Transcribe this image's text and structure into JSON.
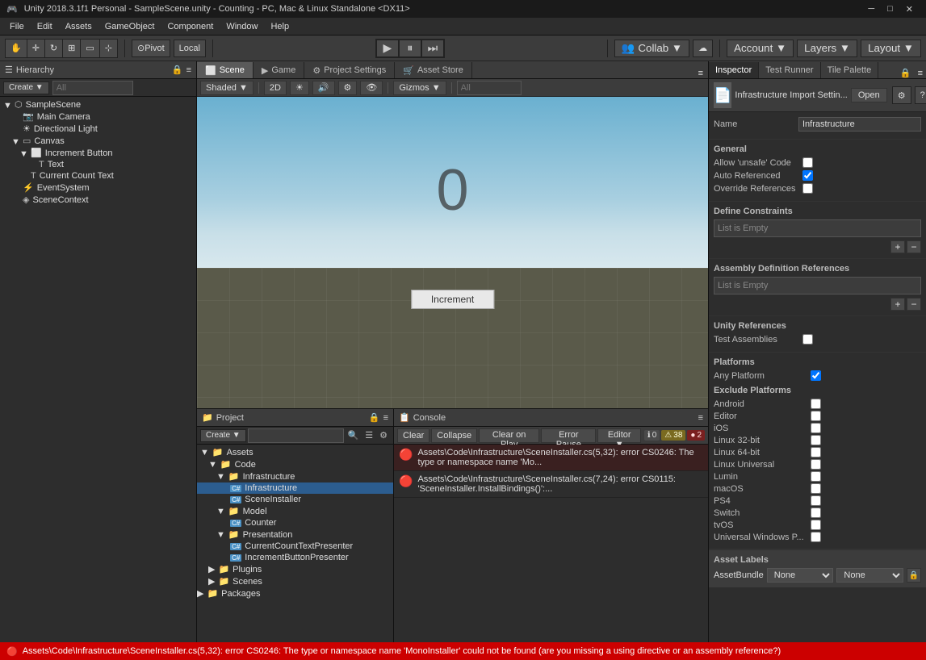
{
  "titlebar": {
    "text": "Unity 2018.3.1f1 Personal - SampleScene.unity - Counting - PC, Mac & Linux Standalone <DX11>"
  },
  "menubar": {
    "items": [
      "File",
      "Edit",
      "Assets",
      "GameObject",
      "Component",
      "Window",
      "Help"
    ]
  },
  "toolbar": {
    "pivot_label": "Pivot",
    "local_label": "Local",
    "play_icon": "▶",
    "pause_icon": "⏸",
    "step_icon": "⏭",
    "collab_label": "Collab ▼",
    "cloud_icon": "☁",
    "account_label": "Account ▼",
    "layers_label": "Layers ▼",
    "layout_label": "Layout ▼"
  },
  "hierarchy": {
    "title": "Hierarchy",
    "create_label": "Create ▼",
    "search_placeholder": "All",
    "items": [
      {
        "id": "samplescene",
        "label": "SampleScene",
        "indent": 0,
        "icon": "scene",
        "expanded": true
      },
      {
        "id": "maincamera",
        "label": "Main Camera",
        "indent": 1,
        "icon": "camera"
      },
      {
        "id": "directionallight",
        "label": "Directional Light",
        "indent": 1,
        "icon": "light"
      },
      {
        "id": "canvas",
        "label": "Canvas",
        "indent": 1,
        "icon": "canvas",
        "expanded": true
      },
      {
        "id": "incrementbutton",
        "label": "Increment Button",
        "indent": 2,
        "icon": "button",
        "expanded": true
      },
      {
        "id": "text",
        "label": "Text",
        "indent": 3,
        "icon": "text"
      },
      {
        "id": "currentcounttext",
        "label": "Current Count Text",
        "indent": 2,
        "icon": "text"
      },
      {
        "id": "eventsystem",
        "label": "EventSystem",
        "indent": 1,
        "icon": "event"
      },
      {
        "id": "scenecontext",
        "label": "SceneContext",
        "indent": 1,
        "icon": "context"
      }
    ]
  },
  "scene": {
    "tabs": [
      {
        "label": "Scene",
        "icon": "⬜",
        "active": true
      },
      {
        "label": "Game",
        "icon": "▶",
        "active": false
      },
      {
        "label": "Project Settings",
        "icon": "⚙",
        "active": false
      },
      {
        "label": "Asset Store",
        "icon": "🛒",
        "active": false
      }
    ],
    "toolbar": {
      "shaded_label": "Shaded ▼",
      "twod_label": "2D",
      "gizmos_label": "Gizmos ▼",
      "search_placeholder": "All"
    },
    "counter_value": "0",
    "increment_button": "Increment"
  },
  "project": {
    "title": "Project",
    "create_label": "Create ▼",
    "items": [
      {
        "id": "assets",
        "label": "Assets",
        "indent": 0,
        "type": "folder",
        "expanded": true
      },
      {
        "id": "code",
        "label": "Code",
        "indent": 1,
        "type": "folder",
        "expanded": true
      },
      {
        "id": "infrastructure",
        "label": "Infrastructure",
        "indent": 2,
        "type": "folder",
        "expanded": true
      },
      {
        "id": "infrastructure-file",
        "label": "Infrastructure",
        "indent": 3,
        "type": "cs-file",
        "selected": true
      },
      {
        "id": "sceneinstaller",
        "label": "SceneInstaller",
        "indent": 3,
        "type": "cs-file"
      },
      {
        "id": "model",
        "label": "Model",
        "indent": 2,
        "type": "folder",
        "expanded": true
      },
      {
        "id": "counter",
        "label": "Counter",
        "indent": 3,
        "type": "cs-file"
      },
      {
        "id": "presentation",
        "label": "Presentation",
        "indent": 2,
        "type": "folder",
        "expanded": true
      },
      {
        "id": "currentcounttextpresenter",
        "label": "CurrentCountTextPresenter",
        "indent": 3,
        "type": "cs-file"
      },
      {
        "id": "incrementbuttonpresenter",
        "label": "IncrementButtonPresenter",
        "indent": 3,
        "type": "cs-file"
      },
      {
        "id": "plugins",
        "label": "Plugins",
        "indent": 1,
        "type": "folder"
      },
      {
        "id": "scenes",
        "label": "Scenes",
        "indent": 1,
        "type": "folder"
      },
      {
        "id": "packages",
        "label": "Packages",
        "indent": 0,
        "type": "folder"
      }
    ]
  },
  "console": {
    "title": "Console",
    "buttons": [
      "Clear",
      "Collapse",
      "Clear on Play",
      "Error Pause",
      "Editor ▼"
    ],
    "badges": [
      {
        "type": "info",
        "icon": "ℹ",
        "count": "0"
      },
      {
        "type": "warn",
        "icon": "⚠",
        "count": "38"
      },
      {
        "type": "err",
        "icon": "🔴",
        "count": "2"
      }
    ],
    "errors": [
      {
        "text": "Assets\\Code\\Infrastructure\\SceneInstaller.cs(5,32): error CS0246: The type or namespace name 'Mo..."
      },
      {
        "text": "Assets\\Code\\Infrastructure\\SceneInstaller.cs(7,24): error CS0115: 'SceneInstaller.InstallBindings()':..."
      }
    ]
  },
  "inspector": {
    "tabs": [
      "Inspector",
      "Test Runner",
      "Tile Palette"
    ],
    "active_tab": "Inspector",
    "file_title": "Infrastructure Import Settin...",
    "open_button": "Open",
    "name_label": "Name",
    "name_value": "Infrastructure",
    "sections": {
      "general": {
        "label": "General",
        "fields": [
          {
            "label": "Allow 'unsafe' Code",
            "type": "checkbox",
            "value": false
          },
          {
            "label": "Auto Referenced",
            "type": "checkbox",
            "value": true
          },
          {
            "label": "Override References",
            "type": "checkbox",
            "value": false
          }
        ]
      },
      "define_constraints": {
        "label": "Define Constraints",
        "list_text": "List is Empty"
      },
      "assembly_refs": {
        "label": "Assembly Definition References",
        "list_text": "List is Empty"
      },
      "unity_refs": {
        "label": "Unity References",
        "test_assemblies_label": "Test Assemblies",
        "test_assemblies_value": false
      },
      "platforms": {
        "label": "Platforms",
        "any_platform_label": "Any Platform",
        "any_platform_value": true,
        "exclude_label": "Exclude Platforms",
        "platform_list": [
          {
            "name": "Android",
            "value": false
          },
          {
            "name": "Editor",
            "value": false
          },
          {
            "name": "iOS",
            "value": false
          },
          {
            "name": "Linux 32-bit",
            "value": false
          },
          {
            "name": "Linux 64-bit",
            "value": false
          },
          {
            "name": "Linux Universal",
            "value": false
          },
          {
            "name": "Lumin",
            "value": false
          },
          {
            "name": "macOS",
            "value": false
          },
          {
            "name": "PS4",
            "value": false
          },
          {
            "name": "Switch",
            "value": false
          },
          {
            "name": "tvOS",
            "value": false
          },
          {
            "name": "Universal Windows P...",
            "value": false
          }
        ]
      }
    },
    "asset_labels": {
      "label": "Asset Labels",
      "asset_bundle_label": "AssetBundle",
      "none_option": "None"
    }
  },
  "statusbar": {
    "text": "Assets\\Code\\Infrastructure\\SceneInstaller.cs(5,32): error CS0246: The type or namespace name 'MonoInstaller' could not be found (are you missing a using directive or an assembly reference?)"
  }
}
